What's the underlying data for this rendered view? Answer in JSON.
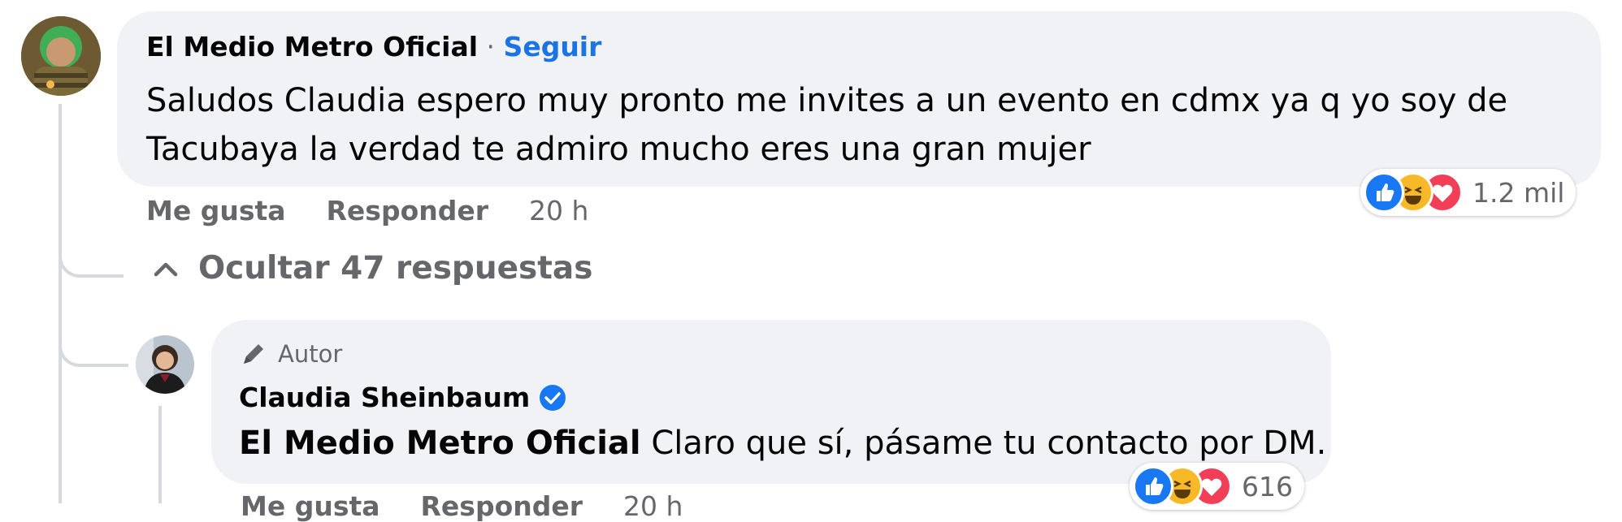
{
  "comment": {
    "author": "El Medio Metro Oficial",
    "separator": " · ",
    "follow_label": "Seguir",
    "text_line1": "Saludos Claudia espero muy pronto me invites a un evento en cdmx ya q yo soy de",
    "text_line2": "Tacubaya la verdad te admiro mucho eres una gran mujer",
    "like_label": "Me gusta",
    "reply_label": "Responder",
    "time": "20 h",
    "reaction_count": "1.2 mil",
    "reactions": [
      "like-icon",
      "haha-icon",
      "love-icon"
    ]
  },
  "replies_toggle": {
    "label": "Ocultar 47 respuestas"
  },
  "reply": {
    "badge": "Autor",
    "author": "Claudia Sheinbaum",
    "verified": true,
    "mention": "El Medio Metro Oficial",
    "text": " Claro que sí, pásame tu contacto por DM.",
    "reaction_count": "616",
    "reactions": [
      "like-icon",
      "haha-icon",
      "love-icon"
    ],
    "like_label": "Me gusta",
    "reply_label": "Responder",
    "time": "20 h"
  },
  "colors": {
    "bubble": "#f0f2f5",
    "link": "#1b74e4",
    "secondary_text": "#65676b",
    "like": "#1877f2",
    "haha": "#f7b928",
    "love": "#f33e58"
  }
}
